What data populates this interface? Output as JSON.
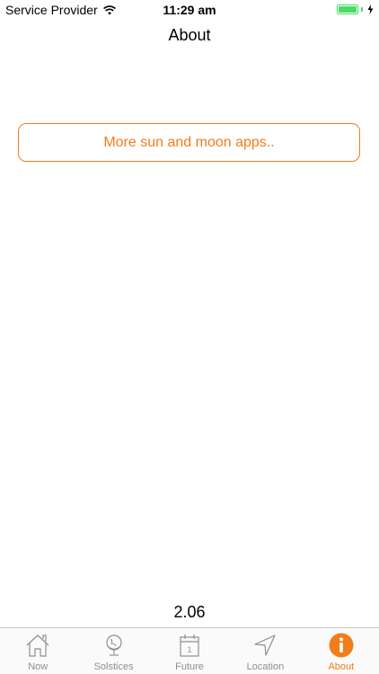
{
  "status_bar": {
    "carrier": "Service Provider",
    "time": "11:29 am",
    "battery_level": 1.0,
    "charging_icon": "bolt-icon",
    "wifi_icon": "wifi-icon"
  },
  "nav": {
    "title": "About"
  },
  "content": {
    "more_apps_label": "More sun and moon apps..",
    "version": "2.06"
  },
  "tab_bar": {
    "tabs": [
      {
        "label": "Now",
        "icon": "house-icon",
        "active": false
      },
      {
        "label": "Solstices",
        "icon": "globe-icon",
        "active": false
      },
      {
        "label": "Future",
        "icon": "calendar-icon",
        "active": false
      },
      {
        "label": "Location",
        "icon": "location-arrow-icon",
        "active": false
      },
      {
        "label": "About",
        "icon": "info-icon",
        "active": true
      }
    ]
  },
  "colors": {
    "accent": "#f07d1a",
    "inactive": "#8e8e8e",
    "battery": "#4cd964"
  }
}
